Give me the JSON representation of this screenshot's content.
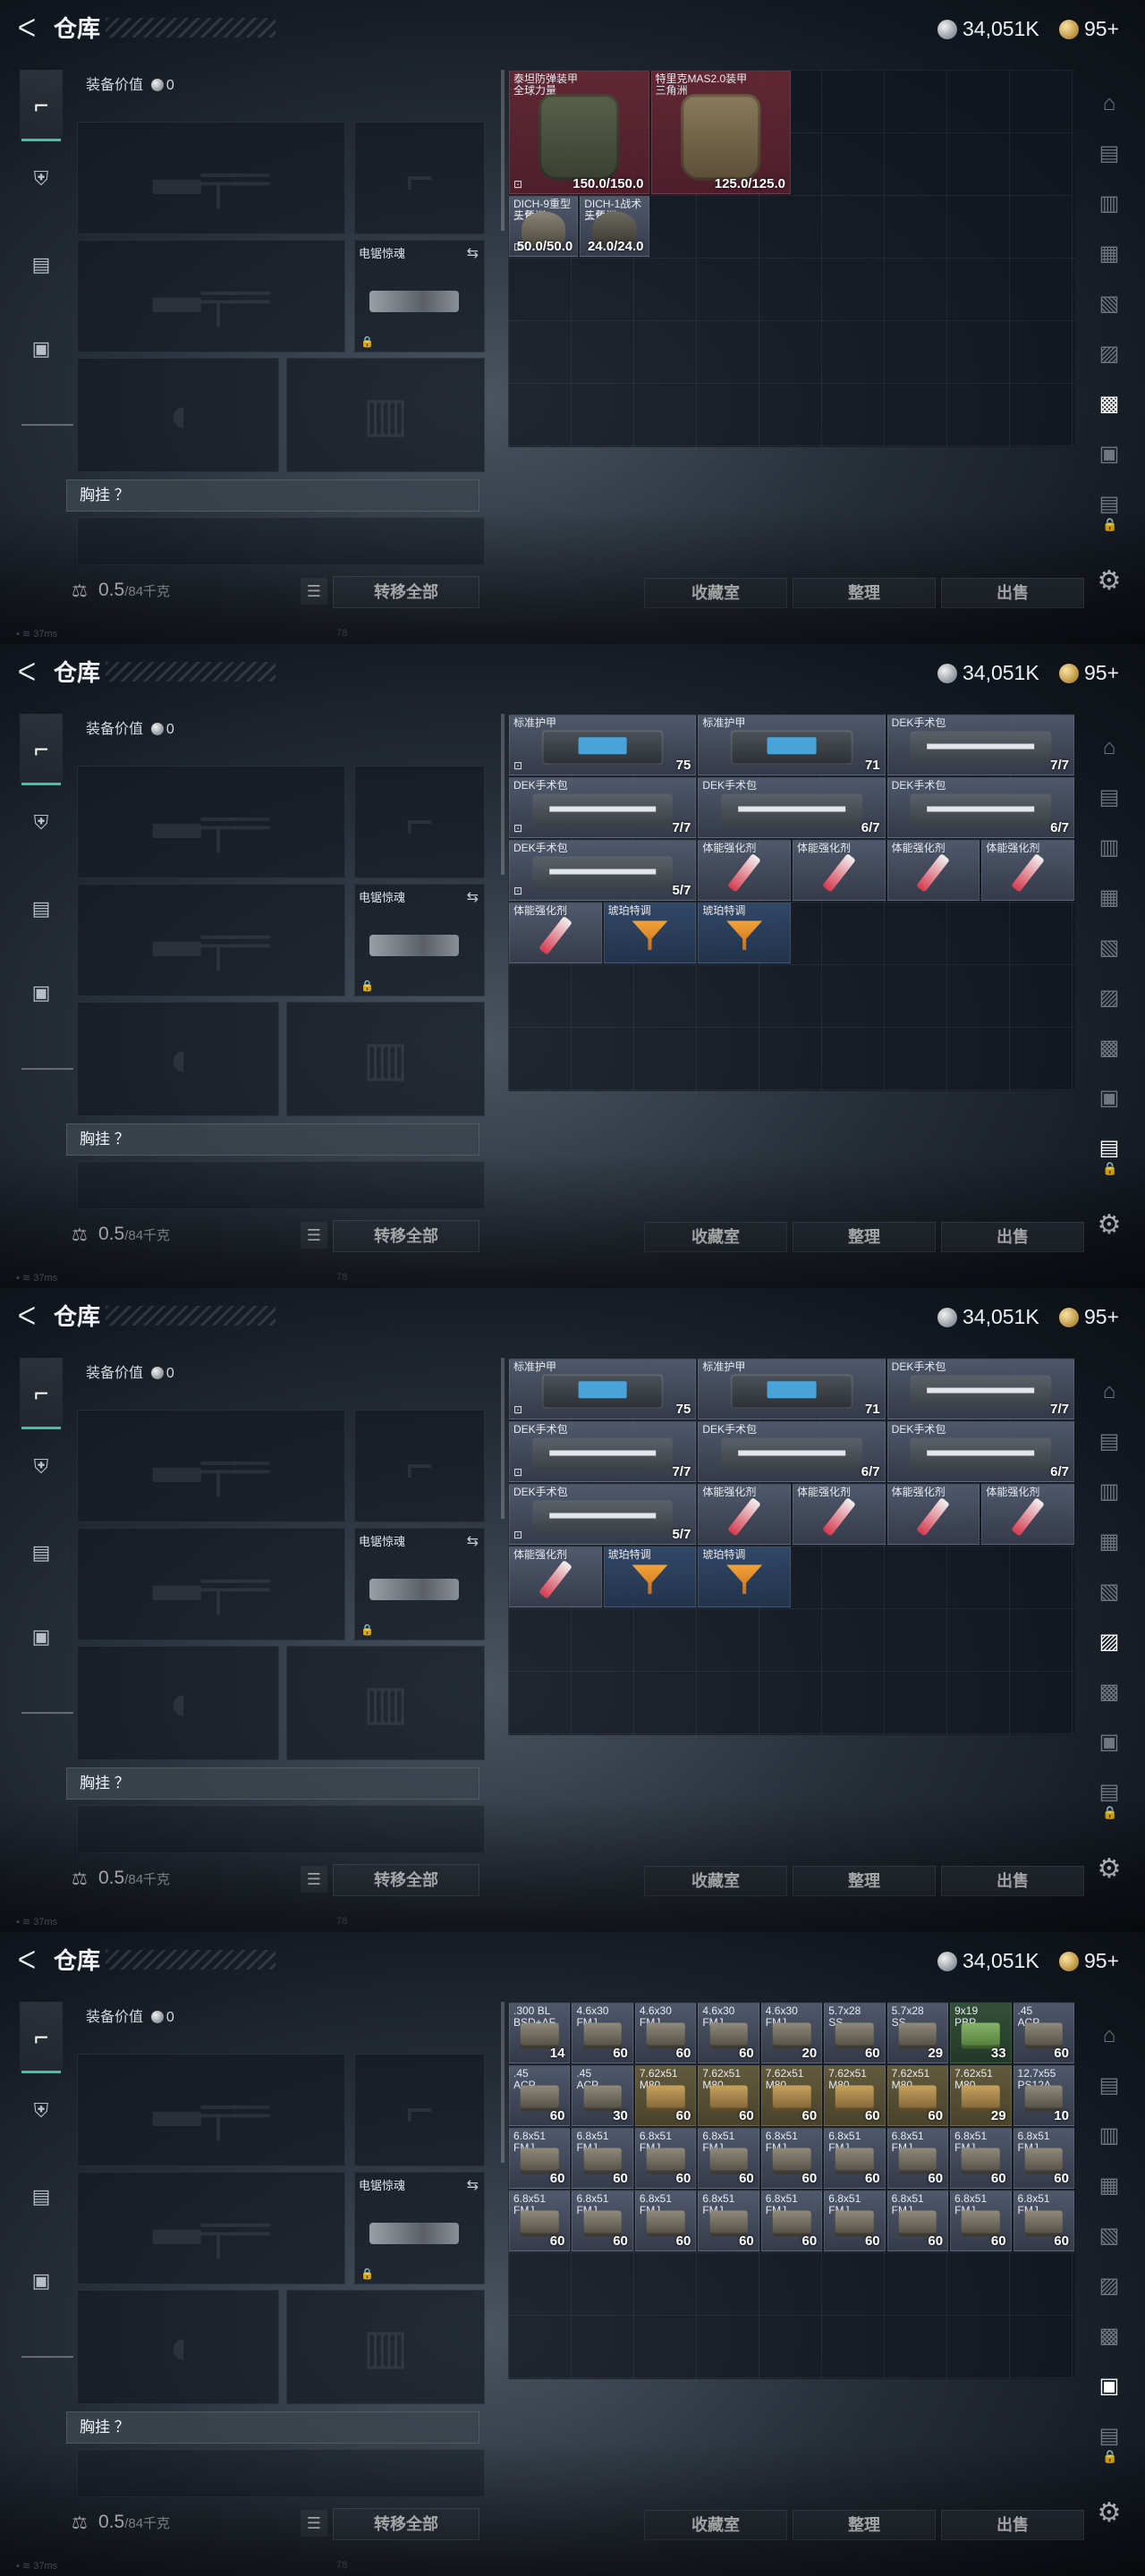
{
  "header": {
    "title": "仓库",
    "currency_a": "34,051K",
    "currency_b": "95+"
  },
  "status": {
    "network": "37ms",
    "fps": "78"
  },
  "left": {
    "value_label": "装备价值",
    "value": "0",
    "melee_label": "电锯惊魂",
    "chest_label": "胸挂 ？",
    "weight": "0.5",
    "weight_max": "/84千克",
    "transfer_all": "转移全部"
  },
  "actions": {
    "collection": "收藏室",
    "sort": "整理",
    "sell": "出售"
  },
  "icons": {
    "back": "back-arrow-icon",
    "gear": "gear-icon",
    "lock": "lock-icon",
    "list": "list-icon",
    "swap": "swap-icon"
  },
  "screens": [
    {
      "items": [
        {
          "name": "泰坦防弹装甲",
          "sub": "全球力量",
          "qty": "150.0/150.0",
          "art": "vest",
          "tone": "red",
          "badge": "⊡"
        },
        {
          "name": "特里克MAS2.0装甲",
          "sub": "三角洲",
          "qty": "125.0/125.0",
          "art": "vest tan",
          "tone": "red"
        },
        {
          "name": "DICH-9重型头盔",
          "sub": "三角洲",
          "qty": "50.0/50.0",
          "art": "helmet",
          "tone": "grey",
          "badge": "⊡"
        },
        {
          "name": "DICH-1战术头盔",
          "sub": "三角洲",
          "qty": "24.0/24.0",
          "art": "helmet dark",
          "tone": "grey"
        }
      ]
    },
    {
      "items": [
        {
          "name": "标准护甲",
          "qty": "75",
          "art": "case",
          "badge": "⊡"
        },
        {
          "name": "标准护甲",
          "qty": "71",
          "art": "case"
        },
        {
          "name": "DEK手术包",
          "qty": "7/7",
          "art": "medkit"
        },
        {
          "name": "DEK手术包",
          "qty": "7/7",
          "art": "medkit",
          "badge": "⊡"
        },
        {
          "name": "DEK手术包",
          "qty": "6/7",
          "art": "medkit"
        },
        {
          "name": "DEK手术包",
          "qty": "6/7",
          "art": "medkit"
        },
        {
          "name": "DEK手术包",
          "qty": "5/7",
          "art": "medkit",
          "badge": "⊡"
        },
        {
          "name": "体能强化剂",
          "qty": "",
          "art": "syringe"
        },
        {
          "name": "体能强化剂",
          "qty": "",
          "art": "syringe"
        },
        {
          "name": "体能强化剂",
          "qty": "",
          "art": "syringe"
        },
        {
          "name": "体能强化剂",
          "qty": "",
          "art": "syringe"
        },
        {
          "name": "体能强化剂",
          "qty": "",
          "art": "syringe"
        },
        {
          "name": "琥珀特调",
          "qty": "",
          "art": "cocktail",
          "tone": "blue"
        },
        {
          "name": "琥珀特调",
          "qty": "",
          "art": "cocktail",
          "tone": "blue"
        }
      ]
    },
    {
      "items": [
        {
          "name": "标准护甲",
          "qty": "75",
          "art": "case",
          "badge": "⊡"
        },
        {
          "name": "标准护甲",
          "qty": "71",
          "art": "case"
        },
        {
          "name": "DEK手术包",
          "qty": "7/7",
          "art": "medkit"
        },
        {
          "name": "DEK手术包",
          "qty": "7/7",
          "art": "medkit",
          "badge": "⊡"
        },
        {
          "name": "DEK手术包",
          "qty": "6/7",
          "art": "medkit"
        },
        {
          "name": "DEK手术包",
          "qty": "6/7",
          "art": "medkit"
        },
        {
          "name": "DEK手术包",
          "qty": "5/7",
          "art": "medkit",
          "badge": "⊡"
        },
        {
          "name": "体能强化剂",
          "qty": "",
          "art": "syringe"
        },
        {
          "name": "体能强化剂",
          "qty": "",
          "art": "syringe"
        },
        {
          "name": "体能强化剂",
          "qty": "",
          "art": "syringe"
        },
        {
          "name": "体能强化剂",
          "qty": "",
          "art": "syringe"
        },
        {
          "name": "体能强化剂",
          "qty": "",
          "art": "syringe"
        },
        {
          "name": "琥珀特调",
          "qty": "",
          "art": "cocktail",
          "tone": "blue"
        },
        {
          "name": "琥珀特调",
          "qty": "",
          "art": "cocktail",
          "tone": "blue"
        }
      ]
    },
    {
      "items": [
        {
          "name": ".300 BL",
          "sub": "BSD+AF",
          "qty": "14",
          "art": "ammo",
          "tone": "grey"
        },
        {
          "name": "4.6x30",
          "sub": "FMJ",
          "qty": "60",
          "art": "ammo",
          "tone": "grey"
        },
        {
          "name": "4.6x30",
          "sub": "FMJ",
          "qty": "60",
          "art": "ammo",
          "tone": "grey"
        },
        {
          "name": "4.6x30",
          "sub": "FMJ",
          "qty": "60",
          "art": "ammo",
          "tone": "grey"
        },
        {
          "name": "4.6x30",
          "sub": "FMJ",
          "qty": "20",
          "art": "ammo",
          "tone": "grey"
        },
        {
          "name": "5.7x28",
          "sub": "SS",
          "qty": "60",
          "art": "ammo",
          "tone": "grey"
        },
        {
          "name": "5.7x28",
          "sub": "SS",
          "qty": "29",
          "art": "ammo",
          "tone": "grey"
        },
        {
          "name": "9x19",
          "sub": "PBP",
          "qty": "33",
          "art": "ammo green",
          "tone": "green"
        },
        {
          "name": ".45",
          "sub": "ACP",
          "qty": "60",
          "art": "ammo",
          "tone": "grey"
        },
        {
          "name": ".45",
          "sub": "ACP",
          "qty": "60",
          "art": "ammo",
          "tone": "grey"
        },
        {
          "name": ".45",
          "sub": "ACP",
          "qty": "30",
          "art": "ammo",
          "tone": "grey"
        },
        {
          "name": "7.62x51",
          "sub": "M80",
          "qty": "60",
          "art": "ammo gold",
          "tone": "yellow"
        },
        {
          "name": "7.62x51",
          "sub": "M80",
          "qty": "60",
          "art": "ammo gold",
          "tone": "yellow"
        },
        {
          "name": "7.62x51",
          "sub": "M80",
          "qty": "60",
          "art": "ammo gold",
          "tone": "yellow"
        },
        {
          "name": "7.62x51",
          "sub": "M80",
          "qty": "60",
          "art": "ammo gold",
          "tone": "yellow"
        },
        {
          "name": "7.62x51",
          "sub": "M80",
          "qty": "60",
          "art": "ammo gold",
          "tone": "yellow"
        },
        {
          "name": "7.62x51",
          "sub": "M80",
          "qty": "29",
          "art": "ammo gold",
          "tone": "yellow"
        },
        {
          "name": "12.7x55",
          "sub": "PS12A",
          "qty": "10",
          "art": "ammo",
          "tone": "grey"
        },
        {
          "name": "6.8x51",
          "sub": "FMJ",
          "qty": "60",
          "art": "ammo",
          "tone": "grey"
        },
        {
          "name": "6.8x51",
          "sub": "FMJ",
          "qty": "60",
          "art": "ammo",
          "tone": "grey"
        },
        {
          "name": "6.8x51",
          "sub": "FMJ",
          "qty": "60",
          "art": "ammo",
          "tone": "grey"
        },
        {
          "name": "6.8x51",
          "sub": "FMJ",
          "qty": "60",
          "art": "ammo",
          "tone": "grey"
        },
        {
          "name": "6.8x51",
          "sub": "FMJ",
          "qty": "60",
          "art": "ammo",
          "tone": "grey"
        },
        {
          "name": "6.8x51",
          "sub": "FMJ",
          "qty": "60",
          "art": "ammo",
          "tone": "grey"
        },
        {
          "name": "6.8x51",
          "sub": "FMJ",
          "qty": "60",
          "art": "ammo",
          "tone": "grey"
        },
        {
          "name": "6.8x51",
          "sub": "FMJ",
          "qty": "60",
          "art": "ammo",
          "tone": "grey"
        },
        {
          "name": "6.8x51",
          "sub": "FMJ",
          "qty": "60",
          "art": "ammo",
          "tone": "grey"
        },
        {
          "name": "6.8x51",
          "sub": "FMJ",
          "qty": "60",
          "art": "ammo",
          "tone": "grey"
        },
        {
          "name": "6.8x51",
          "sub": "FMJ",
          "qty": "60",
          "art": "ammo",
          "tone": "grey"
        },
        {
          "name": "6.8x51",
          "sub": "FMJ",
          "qty": "60",
          "art": "ammo",
          "tone": "grey"
        },
        {
          "name": "6.8x51",
          "sub": "FMJ",
          "qty": "60",
          "art": "ammo",
          "tone": "grey"
        },
        {
          "name": "6.8x51",
          "sub": "FMJ",
          "qty": "60",
          "art": "ammo",
          "tone": "grey"
        },
        {
          "name": "6.8x51",
          "sub": "FMJ",
          "qty": "60",
          "art": "ammo",
          "tone": "grey"
        },
        {
          "name": "6.8x51",
          "sub": "FMJ",
          "qty": "60",
          "art": "ammo",
          "tone": "grey"
        },
        {
          "name": "6.8x51",
          "sub": "FMJ",
          "qty": "60",
          "art": "ammo",
          "tone": "grey"
        },
        {
          "name": "6.8x51",
          "sub": "FMJ",
          "qty": "60",
          "art": "ammo",
          "tone": "grey"
        }
      ]
    }
  ]
}
